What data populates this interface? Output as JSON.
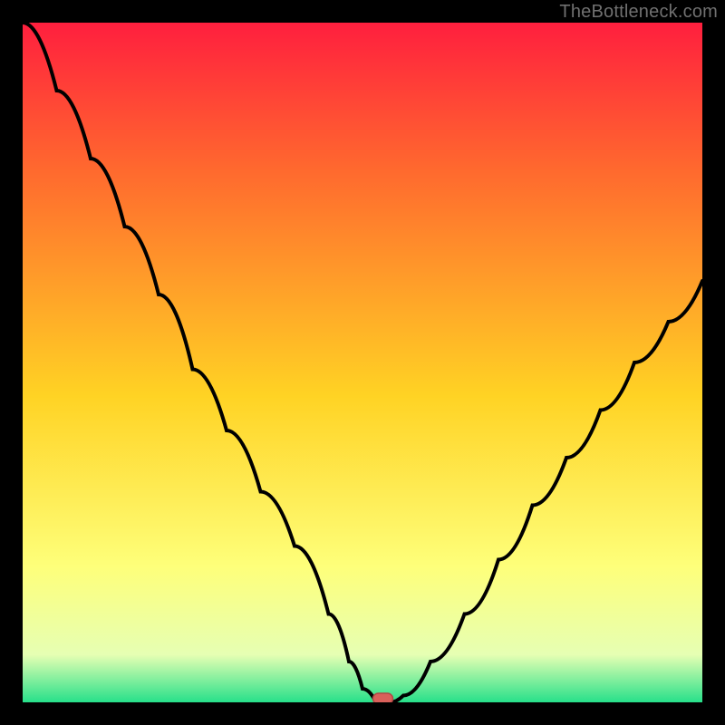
{
  "watermark": "TheBottleneck.com",
  "colors": {
    "frame": "#000000",
    "curve": "#000000",
    "marker_fill": "#d9605a",
    "marker_stroke": "#b24744",
    "grad_top": "#ff1f3e",
    "grad_upper": "#ff6a2e",
    "grad_mid": "#ffd324",
    "grad_low1": "#feff7a",
    "grad_low2": "#e6ffb3",
    "grad_bottom": "#27e08a"
  },
  "chart_data": {
    "type": "line",
    "title": "",
    "xlabel": "",
    "ylabel": "",
    "xlim": [
      0,
      100
    ],
    "ylim": [
      0,
      100
    ],
    "x": [
      0,
      5,
      10,
      15,
      20,
      25,
      30,
      35,
      40,
      45,
      48,
      50,
      52,
      54,
      56,
      60,
      65,
      70,
      75,
      80,
      85,
      90,
      95,
      100
    ],
    "values": [
      100,
      90,
      80,
      70,
      60,
      49,
      40,
      31,
      23,
      13,
      6,
      2,
      0,
      0,
      1,
      6,
      13,
      21,
      29,
      36,
      43,
      50,
      56,
      62
    ],
    "minimum": {
      "x": 53,
      "y": 0
    },
    "background_gradient_stops": [
      {
        "pos": 0.0,
        "color": "#ff1f3e"
      },
      {
        "pos": 0.22,
        "color": "#ff6a2e"
      },
      {
        "pos": 0.55,
        "color": "#ffd324"
      },
      {
        "pos": 0.8,
        "color": "#feff7a"
      },
      {
        "pos": 0.93,
        "color": "#e6ffb3"
      },
      {
        "pos": 1.0,
        "color": "#27e08a"
      }
    ]
  }
}
